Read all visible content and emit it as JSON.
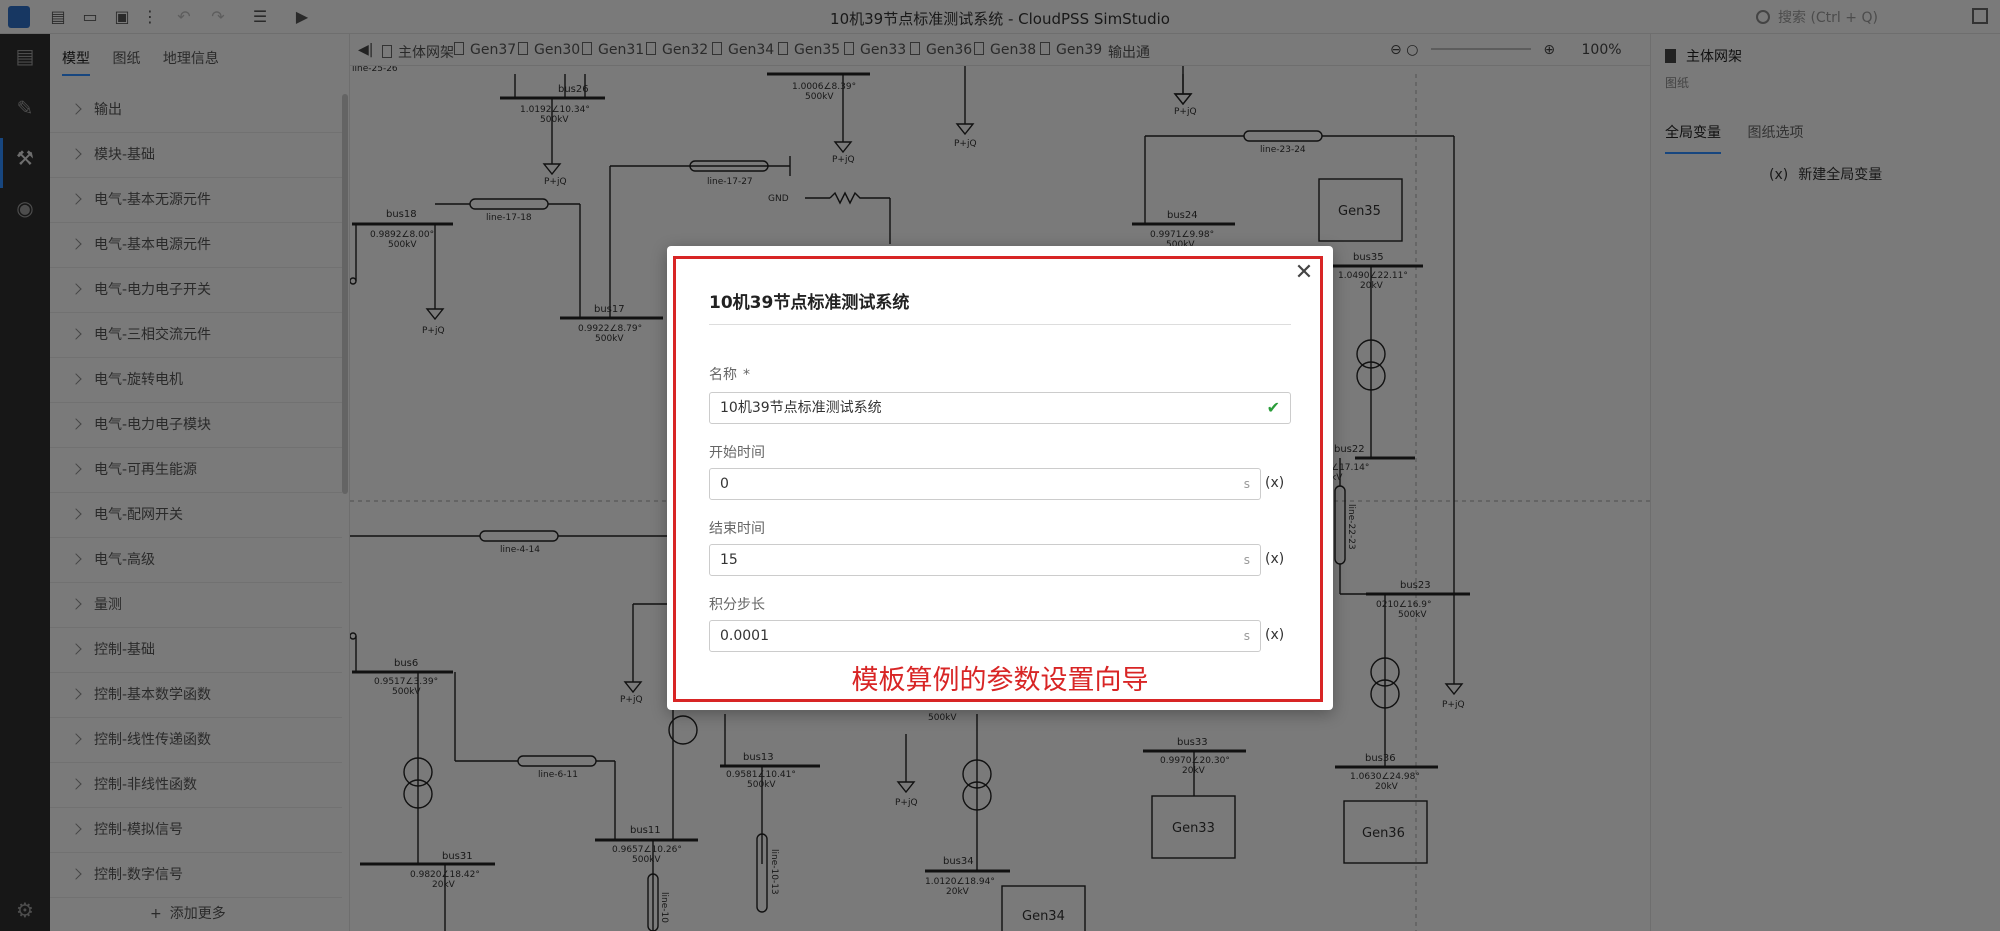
{
  "app": {
    "title": "10机39节点标准测试系统 - CloudPSS SimStudio",
    "search_placeholder": "搜索 (Ctrl + Q)"
  },
  "toolbar": {
    "icons": [
      "new-file-icon",
      "open-folder-icon",
      "save-icon",
      "more-icon",
      "undo-icon",
      "redo-icon",
      "edit-icon",
      "run-icon"
    ]
  },
  "left_panel": {
    "tabs": [
      "模型",
      "图纸",
      "地理信息"
    ],
    "active_tab": 0,
    "items": [
      "输出",
      "模块-基础",
      "电气-基本无源元件",
      "电气-基本电源元件",
      "电气-电力电子开关",
      "电气-三相交流元件",
      "电气-旋转电机",
      "电气-电力电子模块",
      "电气-可再生能源",
      "电气-配网开关",
      "电气-高级",
      "量测",
      "控制-基础",
      "控制-基本数学函数",
      "控制-线性传递函数",
      "控制-非线性函数",
      "控制-模拟信号",
      "控制-数字信号"
    ],
    "add_more": "添加更多"
  },
  "doc_tabs": {
    "items": [
      "主体网架",
      "Gen37",
      "Gen30",
      "Gen31",
      "Gen32",
      "Gen34",
      "Gen35",
      "Gen33",
      "Gen36",
      "Gen38",
      "Gen39",
      "输出通"
    ],
    "zoom_label": "100%"
  },
  "right_panel": {
    "title": "主体网架",
    "subtitle": "图纸",
    "tabs": [
      "全局变量",
      "图纸选项"
    ],
    "active_tab": 0,
    "new_var_label": "新建全局变量",
    "new_var_prefix": "(x)"
  },
  "diagram": {
    "buses": [
      {
        "name": "bus26",
        "info": "1.0192∠10.34°",
        "kv": "500kV"
      },
      {
        "name": "bus18",
        "info": "0.9892∠8.00°",
        "kv": "500kV"
      },
      {
        "name": "bus17",
        "info": "0.9922∠8.79°",
        "kv": "500kV"
      },
      {
        "name": "bus24",
        "info": "0.9971∠9.98°",
        "kv": "500kV"
      },
      {
        "name": "bus35",
        "info": "1.0490∠22.11°",
        "kv": "20kV"
      },
      {
        "name": "bus22",
        "info": "∠17.14°",
        "kv": "kV"
      },
      {
        "name": "bus23",
        "info": "0210∠16.9°",
        "kv": "500kV"
      },
      {
        "name": "bus6",
        "info": "0.9517∠3.39°",
        "kv": "500kV"
      },
      {
        "name": "bus11",
        "info": "0.9657∠10.26°",
        "kv": "500kV"
      },
      {
        "name": "bus13",
        "info": "0.9581∠10.41°",
        "kv": "500kV"
      },
      {
        "name": "bus33",
        "info": "0.9970∠20.30°",
        "kv": "20kV"
      },
      {
        "name": "bus36",
        "info": "1.0630∠24.98°",
        "kv": "20kV"
      },
      {
        "name": "bus31",
        "info": "0.9820∠18.42°",
        "kv": "20kV"
      },
      {
        "name": "bus34",
        "info": "1.0120∠18.94°",
        "kv": "20kV"
      }
    ],
    "lines": [
      "line-25-26",
      "line-17-27",
      "line-17-18",
      "line-23-24",
      "line-4-14",
      "line-22-23",
      "line-6-11",
      "line-10-13",
      "line-10"
    ],
    "gens": [
      "Gen35",
      "Gen33",
      "Gen36",
      "Gen34"
    ],
    "load_label": "P+jQ",
    "gnd_label": "GND"
  },
  "modal": {
    "title": "10机39节点标准测试系统",
    "fields": {
      "name": {
        "label": "名称",
        "required": "*",
        "value": "10机39节点标准测试系统"
      },
      "start": {
        "label": "开始时间",
        "value": "0",
        "unit": "s"
      },
      "end": {
        "label": "结束时间",
        "value": "15",
        "unit": "s"
      },
      "step": {
        "label": "积分步长",
        "value": "0.0001",
        "unit": "s"
      }
    },
    "var_button": "(x)",
    "annotation": "模板算例的参数设置向导"
  }
}
